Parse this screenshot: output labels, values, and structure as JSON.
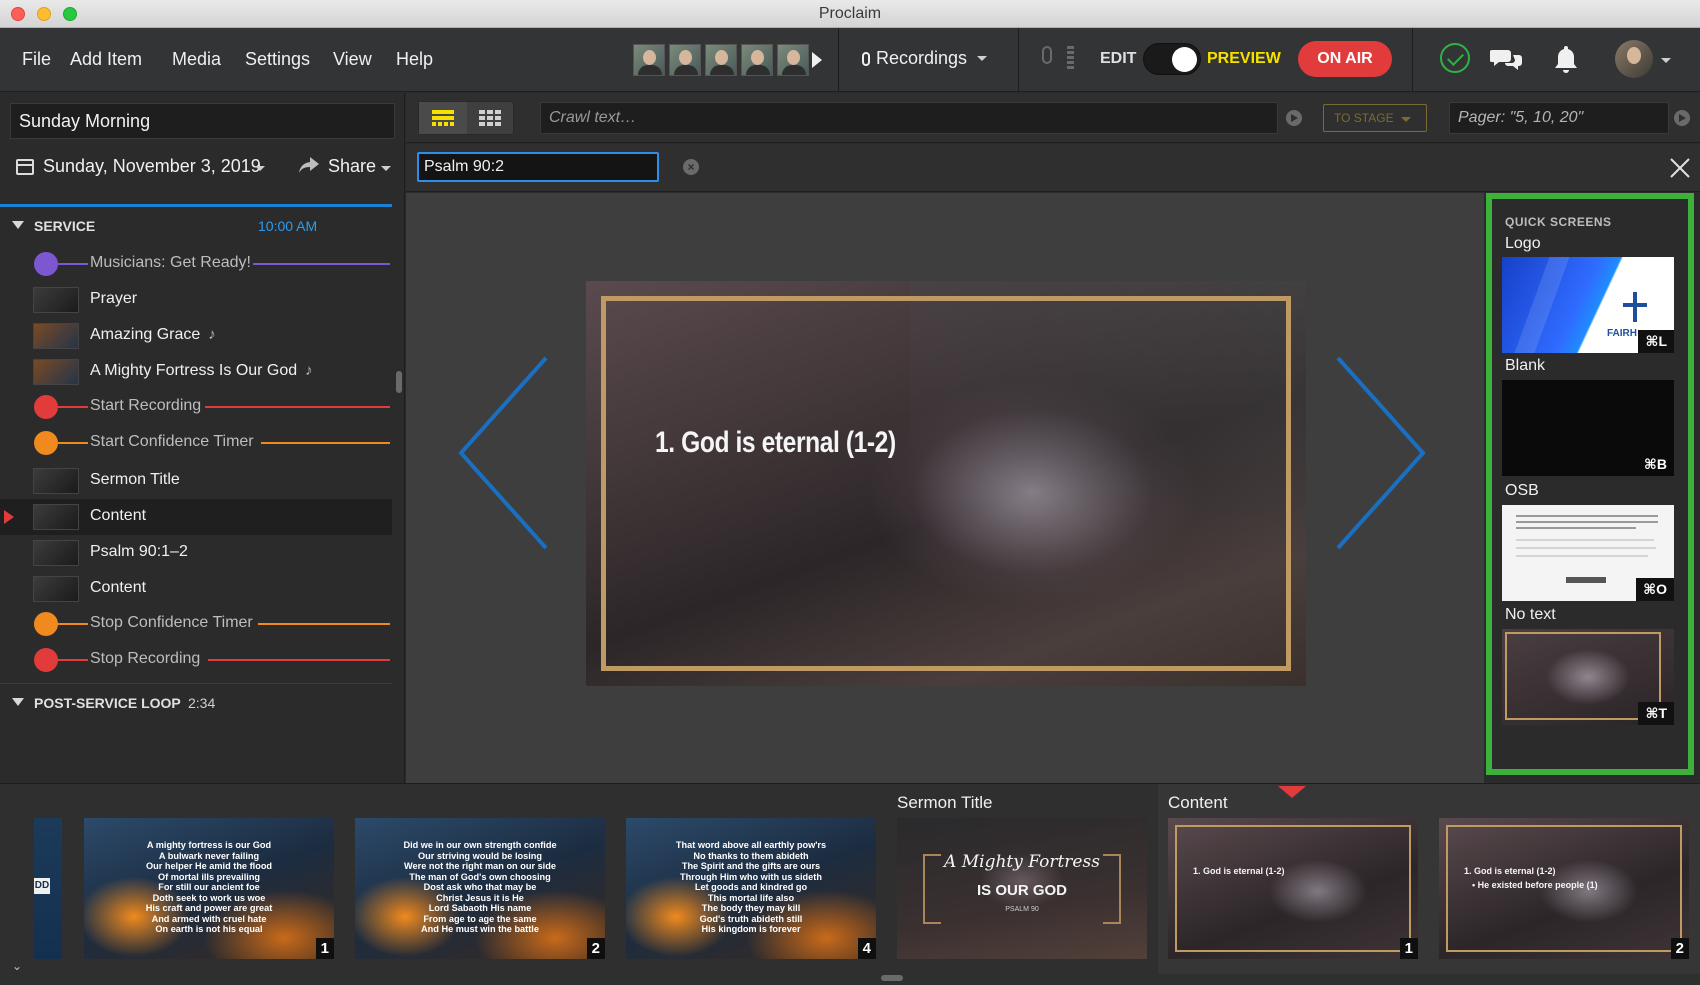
{
  "window": {
    "title": "Proclaim"
  },
  "menu": {
    "file": "File",
    "add_item": "Add Item",
    "media": "Media",
    "settings": "Settings",
    "view": "View",
    "help": "Help"
  },
  "toolbar": {
    "recordings_label": "Recordings",
    "edit_label": "EDIT",
    "preview_label": "PREVIEW",
    "on_air_label": "ON AIR",
    "preview_toggle_on": true
  },
  "sidebar": {
    "presentation_name": "Sunday Morning",
    "date": "Sunday, November 3, 2019",
    "share_label": "Share",
    "sections": [
      {
        "title": "SERVICE",
        "time": "10:00 AM"
      },
      {
        "title": "POST-SERVICE LOOP",
        "duration": "2:34"
      }
    ],
    "items": [
      {
        "label": "Musicians: Get Ready!",
        "kind": "cue",
        "color": "#7b57d1",
        "icon": "megaphone-icon"
      },
      {
        "label": "Prayer",
        "kind": "slide"
      },
      {
        "label": "Amazing Grace",
        "kind": "song"
      },
      {
        "label": "A Mighty Fortress Is Our God",
        "kind": "song"
      },
      {
        "label": "Start Recording",
        "kind": "cue",
        "color": "#e23b3b",
        "icon": "microphone-icon"
      },
      {
        "label": "Start Confidence Timer",
        "kind": "cue",
        "color": "#f08a1e",
        "icon": "clock-icon"
      },
      {
        "label": "Sermon Title",
        "kind": "slide"
      },
      {
        "label": "Content",
        "kind": "slide",
        "selected": true
      },
      {
        "label": "Psalm 90:1–2",
        "kind": "slide"
      },
      {
        "label": "Content",
        "kind": "slide"
      },
      {
        "label": "Stop Confidence Timer",
        "kind": "cue",
        "color": "#f08a1e",
        "icon": "stop-icon"
      },
      {
        "label": "Stop Recording",
        "kind": "cue",
        "color": "#e23b3b",
        "icon": "stop-icon"
      }
    ],
    "note_glyph": "♪"
  },
  "main": {
    "crawl_placeholder": "Crawl text…",
    "to_stage_label": "TO STAGE",
    "pager_placeholder": "Pager: \"5, 10, 20\"",
    "search_value": "Psalm 90:2",
    "slide_text": "1. God is eternal (1-2)"
  },
  "quick_screens": {
    "title": "QUICK SCREENS",
    "items": [
      {
        "label": "Logo",
        "shortcut": "⌘L",
        "logo_word": "FAIRH"
      },
      {
        "label": "Blank",
        "shortcut": "⌘B"
      },
      {
        "label": "OSB",
        "shortcut": "⌘O"
      },
      {
        "label": "No text",
        "shortcut": "⌘T"
      }
    ]
  },
  "filmstrip": {
    "partial_tag": "DD",
    "groups": [
      {
        "label": "Sermon Title"
      },
      {
        "label": "Content"
      }
    ],
    "slides": [
      {
        "number": "1",
        "text": "A mighty fortress is our God\nA bulwark never failing\nOur helper He amid the flood\nOf mortal ills prevailing\nFor still our ancient foe\nDoth seek to work us woe\nHis craft and power are great\nAnd armed with cruel hate\nOn earth is not his equal"
      },
      {
        "number": "2",
        "text": "Did we in our own strength confide\nOur striving would be losing\nWere not the right man on our side\nThe man of God's own choosing\nDost ask who that may be\nChrist Jesus it is He\nLord Sabaoth His name\nFrom age to age the same\nAnd He must win the battle"
      },
      {
        "number": "4",
        "text": "That word above all earthly pow'rs\nNo thanks to them abideth\nThe Spirit and the gifts are ours\nThrough Him who with us sideth\nLet goods and kindred go\nThis mortal life also\nThe body they may kill\nGod's truth abideth still\nHis kingdom is forever"
      }
    ],
    "sermon_title": {
      "line1": "A Mighty Fortress",
      "line2": "IS OUR GOD",
      "line3": "PSALM 90"
    },
    "content_slides": [
      {
        "number": "1",
        "line1": "1. God is eternal (1-2)"
      },
      {
        "number": "2",
        "line1": "1. God is eternal (1-2)",
        "line2": "• He existed before people (1)"
      }
    ]
  },
  "colors": {
    "accent_blue": "#2c8ee8",
    "on_air_red": "#e23b3b",
    "preview_yellow": "#f5e000",
    "quick_border_green": "#3db23b"
  }
}
